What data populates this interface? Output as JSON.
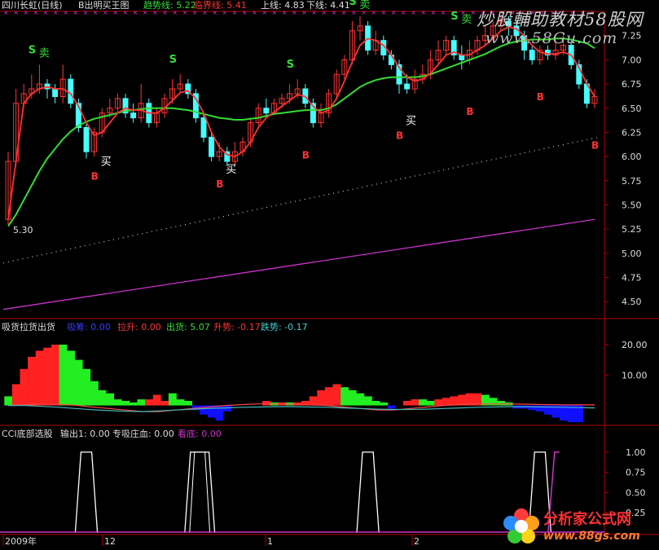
{
  "main_panel": {
    "stock_name": "四川长虹(日线)",
    "indicator_name": "B出明买王图",
    "trend_label": "趋势线: 5.22",
    "critical_label": "临界线: 5.41",
    "upper_label": "上线: 4.83",
    "lower_label": "下线: 4.41",
    "low_marker": "5.30",
    "y_ticks": [
      "7.25",
      "7.00",
      "6.75",
      "6.50",
      "6.25",
      "6.00",
      "5.75",
      "5.50",
      "5.25",
      "5.00",
      "4.75",
      "4.50"
    ],
    "sell_signal": "S",
    "buy_signal": "B",
    "sell_char": "卖",
    "buy_char": "买"
  },
  "sub_panel_1": {
    "title": "吸货拉货出货",
    "absorb_label": "吸筹: 0.00",
    "pull_label": "拉升: 0.00",
    "ship_label": "出货: 5.07",
    "rise_label": "升势: -0.17",
    "fall_label": "跌势: -0.17",
    "y_ticks": [
      "20.00",
      "10.00"
    ]
  },
  "sub_panel_2": {
    "title": "CCI底部选股",
    "output_label": "输出1: 0.00",
    "bank_label": "专吸庄血: 0.00",
    "watch_label": "看底: 0.00",
    "y_ticks": [
      "1.00",
      "0.75",
      "0.50",
      "0.25"
    ]
  },
  "time_axis": [
    "2009年",
    "12",
    "1",
    "2"
  ],
  "watermarks": {
    "top_line1": "炒股輔助教材58股网",
    "top_line2": "www.58Gu.com",
    "bottom_line1": "分析家公式网",
    "bottom_line2": "www.88gs.com"
  },
  "colors": {
    "up_candle": "#ff3333",
    "down_candle": "#44ffff",
    "trend_line": "#ff3333",
    "ma_line": "#33dd33",
    "purple_line": "#cc33cc",
    "dotted_line": "#cccccc",
    "axis": "#cc0000",
    "green_bar": "#22ee22",
    "red_bar": "#ff2222",
    "blue_bar": "#1010ff"
  },
  "chart_data": [
    {
      "type": "candlestick",
      "title": "B出明买王图",
      "ylim": [
        4.35,
        7.45
      ],
      "candles": [
        [
          5.35,
          5.95,
          6.05,
          5.3
        ],
        [
          5.95,
          6.55,
          6.7,
          5.9
        ],
        [
          6.55,
          6.65,
          6.75,
          6.5
        ],
        [
          6.65,
          6.7,
          6.85,
          6.6
        ],
        [
          6.7,
          6.75,
          6.95,
          6.65
        ],
        [
          6.75,
          6.7,
          6.8,
          6.6
        ],
        [
          6.7,
          6.62,
          6.75,
          6.55
        ],
        [
          6.62,
          6.8,
          6.95,
          6.55
        ],
        [
          6.8,
          6.55,
          6.85,
          6.5
        ],
        [
          6.55,
          6.3,
          6.6,
          6.25
        ],
        [
          6.3,
          6.05,
          6.35,
          5.98
        ],
        [
          6.05,
          6.25,
          6.3,
          6.0
        ],
        [
          6.25,
          6.45,
          6.5,
          6.2
        ],
        [
          6.45,
          6.5,
          6.6,
          6.4
        ],
        [
          6.5,
          6.6,
          6.65,
          6.45
        ],
        [
          6.6,
          6.45,
          6.65,
          6.4
        ],
        [
          6.45,
          6.4,
          6.55,
          6.35
        ],
        [
          6.4,
          6.55,
          6.75,
          6.35
        ],
        [
          6.55,
          6.35,
          6.6,
          6.3
        ],
        [
          6.35,
          6.45,
          6.5,
          6.3
        ],
        [
          6.45,
          6.6,
          6.65,
          6.4
        ],
        [
          6.6,
          6.7,
          6.8,
          6.55
        ],
        [
          6.7,
          6.75,
          6.85,
          6.65
        ],
        [
          6.75,
          6.65,
          6.8,
          6.6
        ],
        [
          6.65,
          6.4,
          6.7,
          6.35
        ],
        [
          6.4,
          6.2,
          6.45,
          6.15
        ],
        [
          6.2,
          6.0,
          6.25,
          5.95
        ],
        [
          6.0,
          6.05,
          6.15,
          5.95
        ],
        [
          6.05,
          5.95,
          6.1,
          5.9
        ],
        [
          5.95,
          6.05,
          6.15,
          5.92
        ],
        [
          6.05,
          6.15,
          6.2,
          6.0
        ],
        [
          6.15,
          6.35,
          6.4,
          6.1
        ],
        [
          6.35,
          6.5,
          6.55,
          6.3
        ],
        [
          6.5,
          6.45,
          6.6,
          6.4
        ],
        [
          6.45,
          6.55,
          6.6,
          6.45
        ],
        [
          6.55,
          6.6,
          6.65,
          6.5
        ],
        [
          6.6,
          6.65,
          6.75,
          6.55
        ],
        [
          6.65,
          6.7,
          6.8,
          6.6
        ],
        [
          6.7,
          6.55,
          6.75,
          6.5
        ],
        [
          6.55,
          6.35,
          6.6,
          6.3
        ],
        [
          6.35,
          6.45,
          6.55,
          6.3
        ],
        [
          6.45,
          6.65,
          6.7,
          6.4
        ],
        [
          6.65,
          6.85,
          6.9,
          6.6
        ],
        [
          6.85,
          7.0,
          7.05,
          6.8
        ],
        [
          7.0,
          7.3,
          7.4,
          6.95
        ],
        [
          7.3,
          7.35,
          7.45,
          7.2
        ],
        [
          7.35,
          7.1,
          7.4,
          7.05
        ],
        [
          7.1,
          7.2,
          7.3,
          7.05
        ],
        [
          7.2,
          7.05,
          7.25,
          7.0
        ],
        [
          7.05,
          6.95,
          7.1,
          6.9
        ],
        [
          6.95,
          6.75,
          7.0,
          6.65
        ],
        [
          6.75,
          6.7,
          6.85,
          6.65
        ],
        [
          6.7,
          6.8,
          6.9,
          6.65
        ],
        [
          6.8,
          6.85,
          6.95,
          6.75
        ],
        [
          6.85,
          7.0,
          7.1,
          6.8
        ],
        [
          7.0,
          7.1,
          7.2,
          6.95
        ],
        [
          7.1,
          7.2,
          7.25,
          7.05
        ],
        [
          7.2,
          7.05,
          7.25,
          7.0
        ],
        [
          7.05,
          7.0,
          7.15,
          6.9
        ],
        [
          7.0,
          7.1,
          7.2,
          6.95
        ],
        [
          7.1,
          7.2,
          7.25,
          7.05
        ],
        [
          7.2,
          7.25,
          7.35,
          7.15
        ],
        [
          7.25,
          7.35,
          7.4,
          7.2
        ],
        [
          7.35,
          7.4,
          7.45,
          7.3
        ],
        [
          7.4,
          7.35,
          7.45,
          7.25
        ],
        [
          7.35,
          7.25,
          7.4,
          7.2
        ],
        [
          7.25,
          7.1,
          7.3,
          7.0
        ],
        [
          7.1,
          7.0,
          7.15,
          6.95
        ],
        [
          7.0,
          7.1,
          7.15,
          6.95
        ],
        [
          7.1,
          7.05,
          7.15,
          7.0
        ],
        [
          7.05,
          7.1,
          7.2,
          7.0
        ],
        [
          7.1,
          7.15,
          7.25,
          7.05
        ],
        [
          7.15,
          6.95,
          7.2,
          6.9
        ],
        [
          6.95,
          6.75,
          7.0,
          6.7
        ],
        [
          6.75,
          6.55,
          6.8,
          6.5
        ],
        [
          6.55,
          6.62,
          6.7,
          6.5
        ]
      ],
      "trend_line": [
        5.35,
        5.95,
        6.55,
        6.65,
        6.7,
        6.72,
        6.7,
        6.7,
        6.65,
        6.52,
        6.35,
        6.22,
        6.25,
        6.35,
        6.45,
        6.5,
        6.48,
        6.48,
        6.45,
        6.45,
        6.5,
        6.58,
        6.66,
        6.68,
        6.6,
        6.45,
        6.25,
        6.1,
        6.02,
        6.0,
        6.05,
        6.15,
        6.3,
        6.4,
        6.46,
        6.52,
        6.58,
        6.64,
        6.62,
        6.52,
        6.45,
        6.48,
        6.6,
        6.78,
        6.98,
        7.15,
        7.22,
        7.2,
        7.15,
        7.05,
        6.92,
        6.82,
        6.78,
        6.8,
        6.86,
        6.95,
        7.05,
        7.08,
        7.05,
        7.05,
        7.1,
        7.15,
        7.22,
        7.3,
        7.34,
        7.32,
        7.25,
        7.15,
        7.08,
        7.06,
        7.06,
        7.08,
        7.05,
        6.92,
        6.75,
        6.62
      ],
      "ma_line": [
        5.28,
        5.4,
        5.55,
        5.7,
        5.85,
        5.98,
        6.08,
        6.18,
        6.26,
        6.32,
        6.36,
        6.39,
        6.41,
        6.43,
        6.45,
        6.47,
        6.48,
        6.49,
        6.5,
        6.5,
        6.5,
        6.5,
        6.49,
        6.48,
        6.46,
        6.44,
        6.42,
        6.4,
        6.39,
        6.38,
        6.38,
        6.39,
        6.4,
        6.42,
        6.44,
        6.45,
        6.46,
        6.47,
        6.48,
        6.48,
        6.48,
        6.5,
        6.54,
        6.6,
        6.66,
        6.72,
        6.76,
        6.79,
        6.81,
        6.82,
        6.82,
        6.82,
        6.82,
        6.83,
        6.85,
        6.88,
        6.91,
        6.94,
        6.97,
        7.0,
        7.03,
        7.06,
        7.1,
        7.14,
        7.17,
        7.19,
        7.2,
        7.21,
        7.21,
        7.21,
        7.22,
        7.22,
        7.21,
        7.19,
        7.17,
        7.12
      ],
      "dotted_line": [
        4.9,
        6.2
      ],
      "purple_line": [
        4.42,
        5.35
      ],
      "sell_signals": [
        {
          "i": 3,
          "price": 6.95,
          "char": true
        },
        {
          "i": 21,
          "price": 6.85,
          "char": false
        },
        {
          "i": 36,
          "price": 6.8,
          "char": false
        },
        {
          "i": 44,
          "price": 7.45,
          "char": true
        },
        {
          "i": 57,
          "price": 7.3,
          "char": true
        }
      ],
      "buy_signals": [
        {
          "i": 11,
          "price": 5.98,
          "char": true
        },
        {
          "i": 27,
          "price": 5.9,
          "char": true
        },
        {
          "i": 38,
          "price": 6.2,
          "char": false
        },
        {
          "i": 50,
          "price": 6.4,
          "char": true
        },
        {
          "i": 59,
          "price": 6.65,
          "char": false
        },
        {
          "i": 68,
          "price": 6.8,
          "char": false
        },
        {
          "i": 75,
          "price": 6.3,
          "char": false
        }
      ]
    },
    {
      "type": "bar",
      "title": "吸货拉货出货",
      "ylim": [
        -6,
        24
      ],
      "bars": [
        {
          "i": 0,
          "v": 3,
          "c": "green"
        },
        {
          "i": 1,
          "v": 7,
          "c": "red"
        },
        {
          "i": 2,
          "v": 12,
          "c": "red"
        },
        {
          "i": 3,
          "v": 16,
          "c": "red"
        },
        {
          "i": 4,
          "v": 18,
          "c": "red"
        },
        {
          "i": 5,
          "v": 19,
          "c": "red"
        },
        {
          "i": 6,
          "v": 20,
          "c": "red"
        },
        {
          "i": 7,
          "v": 20,
          "c": "green"
        },
        {
          "i": 8,
          "v": 18,
          "c": "green"
        },
        {
          "i": 9,
          "v": 15,
          "c": "green"
        },
        {
          "i": 10,
          "v": 12,
          "c": "green"
        },
        {
          "i": 11,
          "v": 8,
          "c": "green"
        },
        {
          "i": 12,
          "v": 5,
          "c": "green"
        },
        {
          "i": 13,
          "v": 4,
          "c": "green"
        },
        {
          "i": 14,
          "v": 2,
          "c": "green"
        },
        {
          "i": 15,
          "v": 1.5,
          "c": "green"
        },
        {
          "i": 16,
          "v": 1,
          "c": "green"
        },
        {
          "i": 17,
          "v": 2,
          "c": "green"
        },
        {
          "i": 18,
          "v": 2,
          "c": "red"
        },
        {
          "i": 19,
          "v": 3.5,
          "c": "red"
        },
        {
          "i": 20,
          "v": 1.5,
          "c": "red"
        },
        {
          "i": 21,
          "v": 4,
          "c": "green"
        },
        {
          "i": 22,
          "v": 2,
          "c": "green"
        },
        {
          "i": 23,
          "v": 1.5,
          "c": "green"
        },
        {
          "i": 24,
          "v": -1.5,
          "c": "blue"
        },
        {
          "i": 25,
          "v": -3,
          "c": "blue"
        },
        {
          "i": 26,
          "v": -4,
          "c": "blue"
        },
        {
          "i": 27,
          "v": -5,
          "c": "blue"
        },
        {
          "i": 28,
          "v": -2,
          "c": "blue"
        },
        {
          "i": 33,
          "v": 1.5,
          "c": "red"
        },
        {
          "i": 34,
          "v": 1,
          "c": "green"
        },
        {
          "i": 35,
          "v": 1,
          "c": "red"
        },
        {
          "i": 36,
          "v": 1,
          "c": "green"
        },
        {
          "i": 37,
          "v": 1,
          "c": "red"
        },
        {
          "i": 38,
          "v": 1.5,
          "c": "red"
        },
        {
          "i": 39,
          "v": 3,
          "c": "red"
        },
        {
          "i": 40,
          "v": 5,
          "c": "red"
        },
        {
          "i": 41,
          "v": 6,
          "c": "red"
        },
        {
          "i": 42,
          "v": 7,
          "c": "red"
        },
        {
          "i": 43,
          "v": 6,
          "c": "green"
        },
        {
          "i": 44,
          "v": 5,
          "c": "green"
        },
        {
          "i": 45,
          "v": 4,
          "c": "green"
        },
        {
          "i": 46,
          "v": 3,
          "c": "green"
        },
        {
          "i": 47,
          "v": 1.5,
          "c": "green"
        },
        {
          "i": 48,
          "v": 1,
          "c": "green"
        },
        {
          "i": 49,
          "v": -1,
          "c": "blue"
        },
        {
          "i": 51,
          "v": 1.5,
          "c": "red"
        },
        {
          "i": 52,
          "v": 2,
          "c": "red"
        },
        {
          "i": 53,
          "v": 2,
          "c": "green"
        },
        {
          "i": 54,
          "v": 1.5,
          "c": "green"
        },
        {
          "i": 55,
          "v": 2,
          "c": "red"
        },
        {
          "i": 56,
          "v": 2.5,
          "c": "red"
        },
        {
          "i": 57,
          "v": 3,
          "c": "red"
        },
        {
          "i": 58,
          "v": 3.5,
          "c": "red"
        },
        {
          "i": 59,
          "v": 4,
          "c": "red"
        },
        {
          "i": 60,
          "v": 4,
          "c": "red"
        },
        {
          "i": 61,
          "v": 3.5,
          "c": "green"
        },
        {
          "i": 62,
          "v": 2.5,
          "c": "green"
        },
        {
          "i": 63,
          "v": 1.5,
          "c": "green"
        },
        {
          "i": 64,
          "v": 1,
          "c": "green"
        },
        {
          "i": 65,
          "v": -1,
          "c": "blue"
        },
        {
          "i": 66,
          "v": -1,
          "c": "blue"
        },
        {
          "i": 67,
          "v": -1.5,
          "c": "blue"
        },
        {
          "i": 68,
          "v": -2,
          "c": "blue"
        },
        {
          "i": 69,
          "v": -3,
          "c": "blue"
        },
        {
          "i": 70,
          "v": -4,
          "c": "blue"
        },
        {
          "i": 71,
          "v": -5,
          "c": "blue"
        },
        {
          "i": 72,
          "v": -5.5,
          "c": "blue"
        },
        {
          "i": 73,
          "v": -5.5,
          "c": "blue"
        }
      ],
      "red_line": [
        0,
        0.2,
        0.5,
        0.3,
        0.1,
        -0.5,
        -1,
        -1.5,
        -2,
        -2,
        -1.5,
        -1,
        -0.5,
        0,
        0.3,
        0.5,
        0.5,
        0.4,
        0.2,
        0,
        -0.5,
        -1,
        -1.5,
        -1.5,
        -1,
        -0.5,
        0,
        0.3,
        0.5,
        0.5,
        0.5,
        0.4,
        0.3,
        0.2,
        0.2,
        0.2
      ],
      "teal_line": [
        0,
        0,
        -0.3,
        -0.6,
        -1,
        -1.4,
        -1.7,
        -1.9,
        -2,
        -1.8,
        -1.5,
        -1.2,
        -1,
        -0.8,
        -0.6,
        -0.5,
        -0.4,
        -0.4,
        -0.5,
        -0.6,
        -0.8,
        -1,
        -1.2,
        -1.3,
        -1.3,
        -1.2,
        -1,
        -0.8,
        -0.6,
        -0.5,
        -0.4,
        -0.4,
        -0.5,
        -0.6,
        -0.7,
        -0.8
      ]
    },
    {
      "type": "line",
      "title": "CCI底部选股",
      "ylim": [
        0,
        1.1
      ],
      "pulses": [
        [
          9,
          11
        ],
        [
          23,
          26
        ],
        [
          45,
          47
        ],
        [
          67,
          69
        ]
      ],
      "last_spike_start": 68
    }
  ]
}
